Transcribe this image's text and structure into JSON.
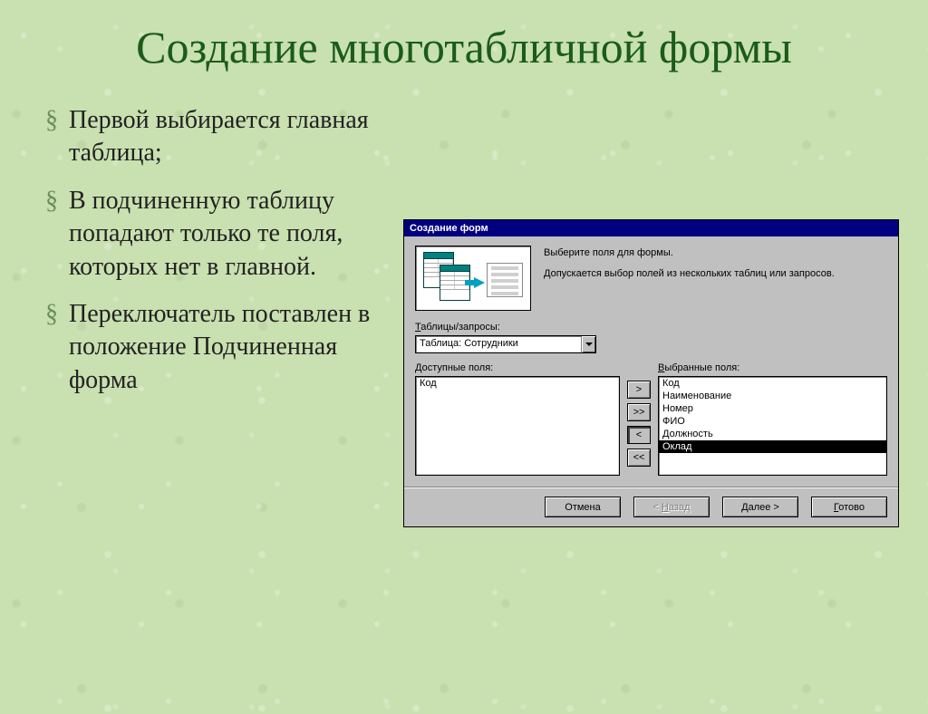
{
  "slide": {
    "title": "Создание многотабличной формы",
    "bullets": [
      "Первой выбирается главная таблица;",
      "В подчиненную таблицу попадают только те поля, которых нет в главной.",
      "Переключатель поставлен в положение Подчиненная форма"
    ]
  },
  "dialog": {
    "title": "Создание форм",
    "instruction1": "Выберите поля для формы.",
    "instruction2": "Допускается выбор полей из нескольких таблиц или запросов.",
    "tables_label": "Таблицы/запросы:",
    "combo_value": "Таблица: Сотрудники",
    "available_label": "Доступные поля:",
    "selected_label": "Выбранные поля:",
    "available_fields": [
      "Код"
    ],
    "selected_fields": [
      "Код",
      "Наименование",
      "Номер",
      "ФИО",
      "Должность",
      "Оклад"
    ],
    "selected_highlight": "Оклад",
    "move_buttons": {
      "add_one": ">",
      "add_all": ">>",
      "remove_one": "<",
      "remove_all": "<<"
    },
    "footer": {
      "cancel": "Отмена",
      "back": "< Назад",
      "next": "Далее >",
      "finish": "Готово"
    }
  }
}
